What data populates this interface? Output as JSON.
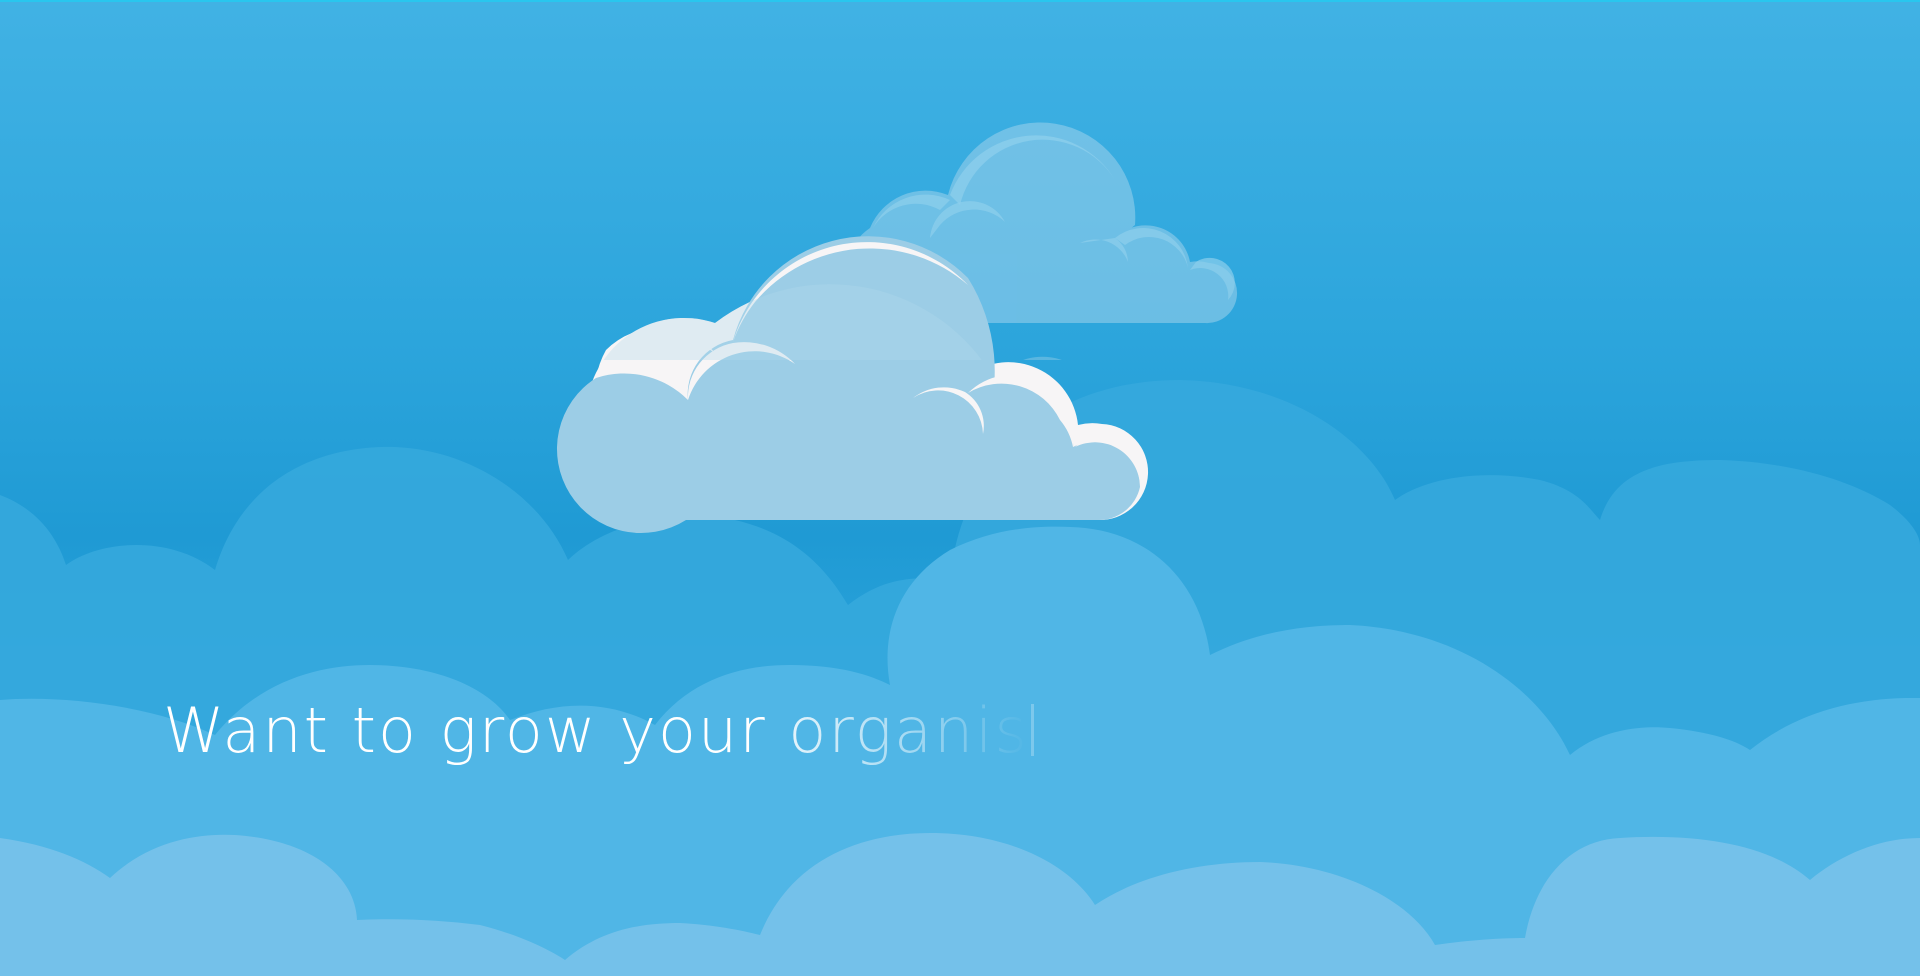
{
  "hero": {
    "headline_solid": "Want to grow your ",
    "headline_fading": "organis"
  },
  "colors": {
    "sky_top": "#41b2e4",
    "sky_mid": "#1f9ad4",
    "cloud_back": "#36a8dd",
    "cloud_mid": "#51b6e6",
    "cloud_front": "#74c2ea",
    "cloud_highlight": "#f7f5f6",
    "accent_line": "#29c6ee"
  },
  "icons": {
    "main_cloud": "cloud-icon",
    "back_cloud": "cloud-icon"
  }
}
